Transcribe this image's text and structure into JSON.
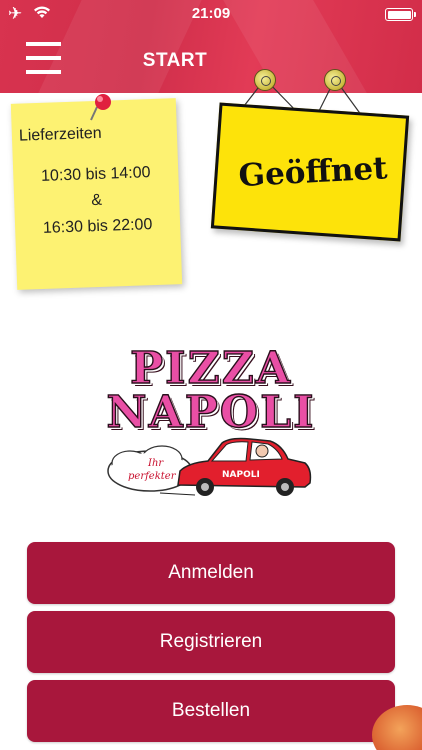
{
  "status_bar": {
    "time": "21:09",
    "icons": [
      "airplane-icon",
      "wifi-icon",
      "battery-icon"
    ]
  },
  "nav": {
    "title": "START",
    "menu_icon": "hamburger-menu-icon"
  },
  "delivery_note": {
    "title": "Lieferzeiten",
    "line1": "10:30 bis 14:00",
    "line2": "&",
    "line3": "16:30 bis 22:00"
  },
  "open_sign": {
    "text": "Geöffnet"
  },
  "logo": {
    "word1": "PIZZA",
    "word2": "NAPOLI",
    "cloud_text": "Ihr perfekter",
    "car_text": "NAPOLI"
  },
  "buttons": {
    "login": "Anmelden",
    "register": "Registrieren",
    "order": "Bestellen"
  },
  "colors": {
    "header": "#d8334f",
    "button": "#a8173c",
    "note": "#fdf272",
    "sign": "#fde30a"
  }
}
